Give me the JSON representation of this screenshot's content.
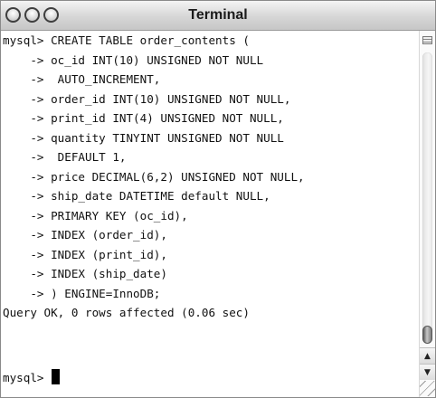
{
  "window": {
    "title": "Terminal"
  },
  "terminal": {
    "lines": [
      "mysql> CREATE TABLE order_contents (",
      "    -> oc_id INT(10) UNSIGNED NOT NULL",
      "    ->  AUTO_INCREMENT,",
      "    -> order_id INT(10) UNSIGNED NOT NULL,",
      "    -> print_id INT(4) UNSIGNED NOT NULL,",
      "    -> quantity TINYINT UNSIGNED NOT NULL",
      "    ->  DEFAULT 1,",
      "    -> price DECIMAL(6,2) UNSIGNED NOT NULL,",
      "    -> ship_date DATETIME default NULL,",
      "    -> PRIMARY KEY (oc_id),",
      "    -> INDEX (order_id),",
      "    -> INDEX (print_id),",
      "    -> INDEX (ship_date)",
      "    -> ) ENGINE=InnoDB;",
      "Query OK, 0 rows affected (0.06 sec)",
      "",
      "mysql>"
    ]
  },
  "icons": {
    "close": "close-button-icon",
    "minimize": "minimize-button-icon",
    "zoom": "zoom-button-icon",
    "split": "split-pane-icon",
    "scroll_up": "arrow-up-icon",
    "scroll_down": "arrow-down-icon",
    "resize": "resize-grip-icon"
  }
}
